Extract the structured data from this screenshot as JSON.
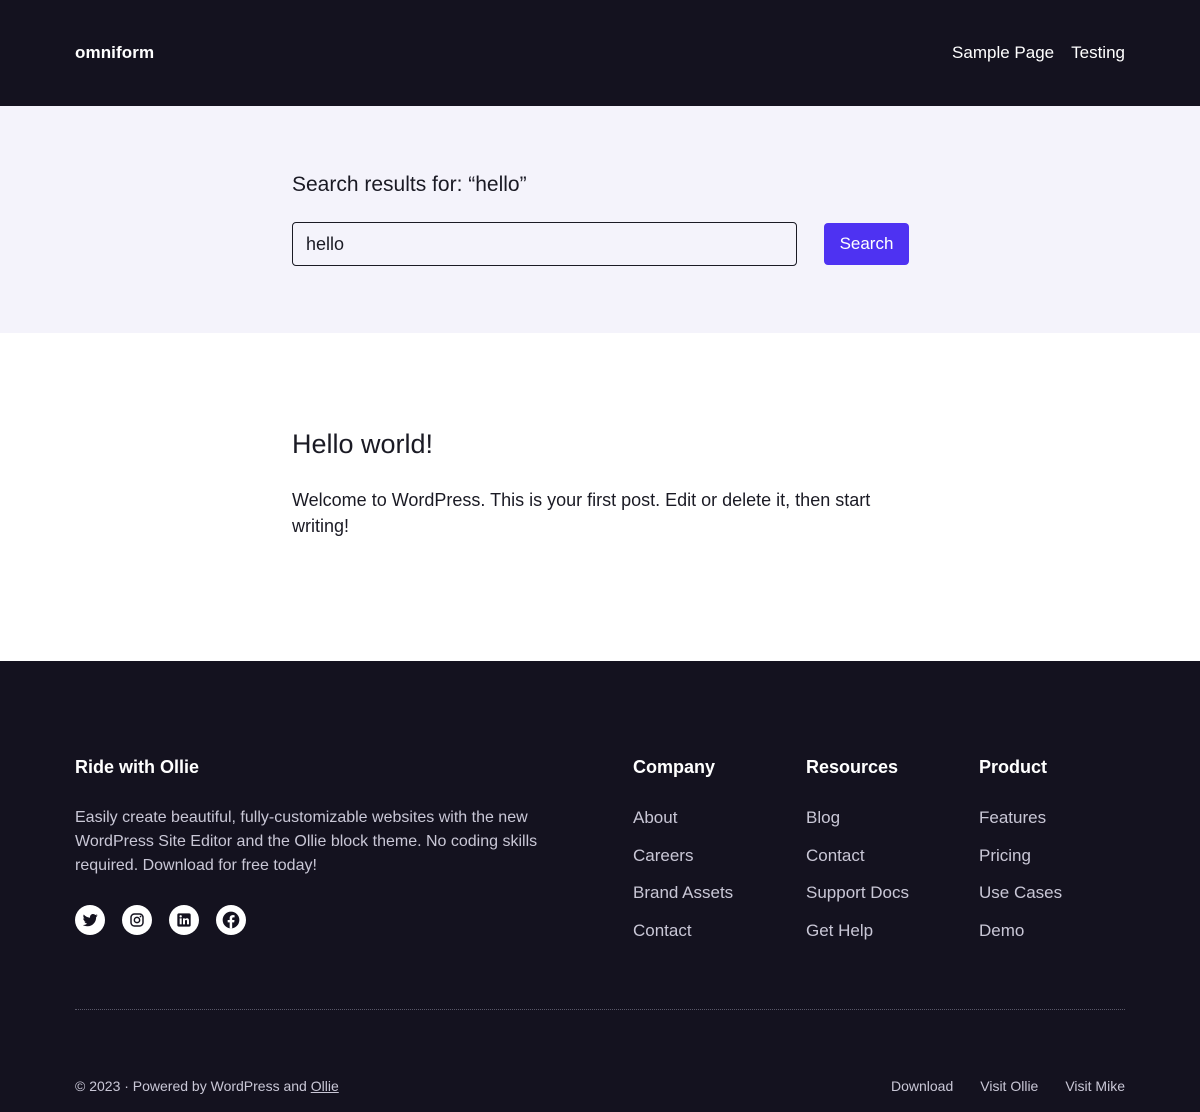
{
  "header": {
    "site_title": "omniform",
    "nav": [
      {
        "label": "Sample Page"
      },
      {
        "label": "Testing"
      }
    ]
  },
  "search": {
    "heading": "Search results for: “hello”",
    "input_value": "hello",
    "button_label": "Search"
  },
  "results": [
    {
      "title": "Hello world!",
      "excerpt": "Welcome to WordPress. This is your first post. Edit or delete it, then start writing!"
    }
  ],
  "footer": {
    "brand_title": "Ride with Ollie",
    "brand_text": "Easily create beautiful, fully-customizable websites with the new WordPress Site Editor and the Ollie block theme. No coding skills required. Download for free today!",
    "socials": [
      {
        "icon": "twitter-icon"
      },
      {
        "icon": "instagram-icon"
      },
      {
        "icon": "linkedin-icon"
      },
      {
        "icon": "facebook-icon"
      }
    ],
    "columns": [
      {
        "title": "Company",
        "links": [
          "About",
          "Careers",
          "Brand Assets",
          "Contact"
        ]
      },
      {
        "title": "Resources",
        "links": [
          "Blog",
          "Contact",
          "Support Docs",
          "Get Help"
        ]
      },
      {
        "title": "Product",
        "links": [
          "Features",
          "Pricing",
          "Use Cases",
          "Demo"
        ]
      }
    ],
    "copyright_prefix": "© 2023 · Powered by WordPress and ",
    "copyright_link": "Ollie",
    "bottom_links": [
      "Download",
      "Visit Ollie",
      "Visit Mike"
    ]
  },
  "colors": {
    "dark_bg": "#14121f",
    "search_bg": "#f4f3fb",
    "accent": "#4e32f2"
  }
}
